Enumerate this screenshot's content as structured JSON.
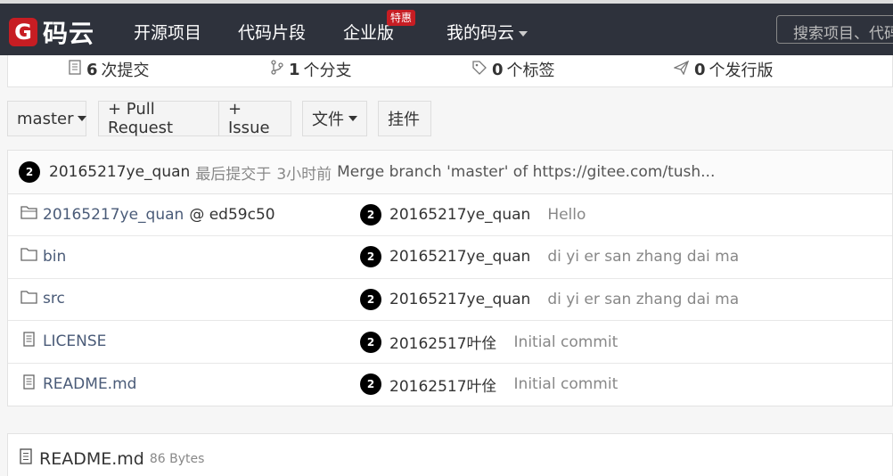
{
  "nav": {
    "logo_letter": "G",
    "logo_text": "码云",
    "items": [
      {
        "label": "开源项目"
      },
      {
        "label": "代码片段"
      },
      {
        "label": "企业版"
      },
      {
        "label": "我的码云"
      }
    ],
    "hot_badge": "特惠",
    "search_placeholder": "搜索项目、代码"
  },
  "stats": {
    "commits": {
      "count": "6",
      "label": "次提交",
      "icon": "commit-icon"
    },
    "branches": {
      "count": "1",
      "label": "个分支",
      "icon": "branch-icon"
    },
    "tags": {
      "count": "0",
      "label": "个标签",
      "icon": "tag-icon"
    },
    "releases": {
      "count": "0",
      "label": "个发行版",
      "icon": "release-icon"
    }
  },
  "toolbar": {
    "branch": "master",
    "pull_request": "+ Pull Request",
    "issue": "+ Issue",
    "files": "文件",
    "widget": "挂件"
  },
  "last_commit": {
    "avatar": "2",
    "author": "20165217ye_quan",
    "label": "最后提交于",
    "time": "3小时前",
    "message": "Merge branch 'master' of https://gitee.com/tush..."
  },
  "files": [
    {
      "icon": "submodule-icon",
      "name": "20165217ye_quan",
      "suffix": "@ ed59c50",
      "avatar": "2",
      "author": "20165217ye_quan",
      "message": "Hello"
    },
    {
      "icon": "folder-icon",
      "name": "bin",
      "suffix": "",
      "avatar": "2",
      "author": "20165217ye_quan",
      "message": "di yi er san zhang dai ma"
    },
    {
      "icon": "folder-icon",
      "name": "src",
      "suffix": "",
      "avatar": "2",
      "author": "20165217ye_quan",
      "message": "di yi er san zhang dai ma"
    },
    {
      "icon": "file-icon",
      "name": "LICENSE",
      "suffix": "",
      "avatar": "2",
      "author": "20162517叶佺",
      "message": "Initial commit"
    },
    {
      "icon": "file-icon",
      "name": "README.md",
      "suffix": "",
      "avatar": "2",
      "author": "20162517叶佺",
      "message": "Initial commit"
    }
  ],
  "readme": {
    "name": "README.md",
    "size": "86 Bytes"
  },
  "colors": {
    "navbar": "#2e323c",
    "brand": "#c71d23",
    "link": "#4a5b78"
  }
}
